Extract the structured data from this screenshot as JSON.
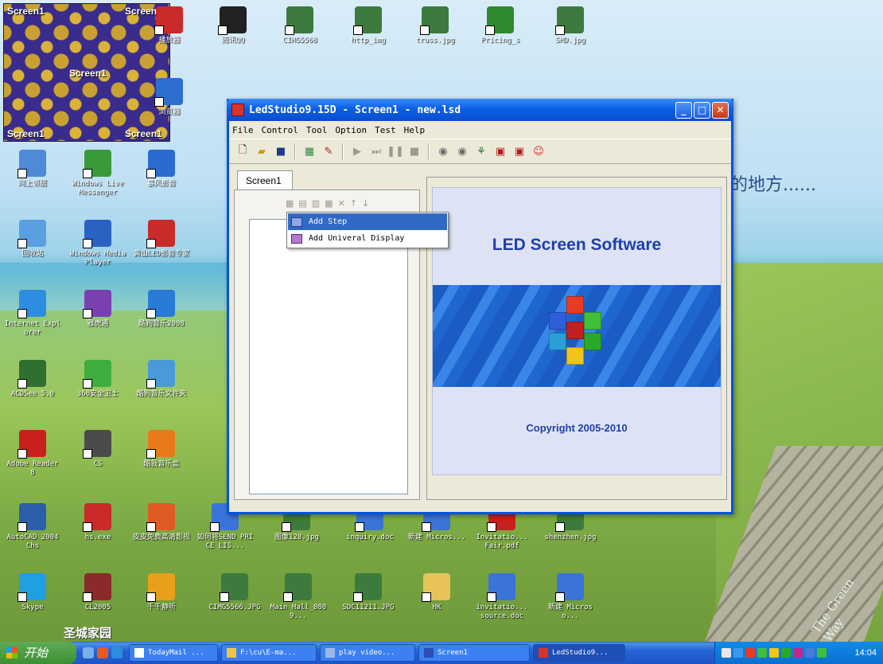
{
  "wallpaper": {
    "slogan": "的地方......",
    "corner_text": "The Green Way",
    "brand": "圣城家园"
  },
  "pattern_window": {
    "labels": [
      "Screen1",
      "Screen1",
      "Screen1",
      "Screen1",
      "Screen1"
    ]
  },
  "desktop_icons": [
    {
      "label": "网上邻居",
      "icon": "network-icon",
      "color": "#4f8ad8"
    },
    {
      "label": "Windows Live Messenger",
      "icon": "messenger-icon",
      "color": "#3a9a3a"
    },
    {
      "label": "暴风影音",
      "icon": "video-player-icon",
      "color": "#2b6bd0"
    },
    {
      "label": "回收站",
      "icon": "recycle-bin-icon",
      "color": "#5aa0e0"
    },
    {
      "label": "Windows Media Player",
      "icon": "media-player-icon",
      "color": "#2a62c4"
    },
    {
      "label": "黄山LED影音专家",
      "icon": "led-app-icon",
      "color": "#c92a2a"
    },
    {
      "label": "Internet Explorer",
      "icon": "ie-icon",
      "color": "#2d8de0"
    },
    {
      "label": "雅虎通",
      "icon": "yahoo-icon",
      "color": "#7a3fb0"
    },
    {
      "label": "酷狗音乐2008",
      "icon": "kugou-icon",
      "color": "#2a7bd6"
    },
    {
      "label": "ACDSee 5.0",
      "icon": "acdsee-icon",
      "color": "#2f6f2f"
    },
    {
      "label": "360安全卫士",
      "icon": "security-icon",
      "color": "#3fae3f"
    },
    {
      "label": "酷狗音乐文件夹",
      "icon": "folder-icon",
      "color": "#4a9ad8"
    },
    {
      "label": "Adobe Reader 8",
      "icon": "pdf-icon",
      "color": "#c8201e"
    },
    {
      "label": "CS",
      "icon": "cs-icon",
      "color": "#4b4b4b"
    },
    {
      "label": "酷我音乐盒",
      "icon": "kuwo-icon",
      "color": "#e87a1a"
    },
    {
      "label": "AutoCAD 2004 Chs",
      "icon": "autocad-icon",
      "color": "#2c5fa8"
    },
    {
      "label": "hs.exe",
      "icon": "exe-icon",
      "color": "#c92a2a"
    },
    {
      "label": "皮皮免费高清影视",
      "icon": "pipi-icon",
      "color": "#e05a24"
    },
    {
      "label": "如何将SEND PRICE LIS...",
      "icon": "doc-icon",
      "color": "#3a74d8"
    },
    {
      "label": "图像128.jpg",
      "icon": "jpg-icon",
      "color": "#3d7a3d"
    },
    {
      "label": "inquiry.doc",
      "icon": "doc-icon",
      "color": "#3a74d8"
    },
    {
      "label": "新建 Micros...",
      "icon": "doc-icon",
      "color": "#3a74d8"
    },
    {
      "label": "Invitatio... Fair.pdf",
      "icon": "pdf-icon",
      "color": "#c8201e"
    },
    {
      "label": "shenzhen.jpg",
      "icon": "jpg-icon",
      "color": "#3d7a3d"
    },
    {
      "label": "Skype",
      "icon": "skype-icon",
      "color": "#1fa0e0"
    },
    {
      "label": "CL2005",
      "icon": "cl-icon",
      "color": "#8a2a2a"
    },
    {
      "label": "千千静听",
      "icon": "ttplayer-icon",
      "color": "#e8a01a"
    },
    {
      "label": "CIMG5566.JPG",
      "icon": "jpg-icon",
      "color": "#3d7a3d"
    },
    {
      "label": "Main Hall_0809...",
      "icon": "jpg-icon",
      "color": "#3d7a3d"
    },
    {
      "label": "SDC11211.JPG",
      "icon": "jpg-icon",
      "color": "#3d7a3d"
    },
    {
      "label": "HK",
      "icon": "folder-icon",
      "color": "#e8c35a"
    },
    {
      "label": "invitatio... source.doc",
      "icon": "doc-icon",
      "color": "#3a74d8"
    },
    {
      "label": "新建 Microso...",
      "icon": "doc-icon",
      "color": "#3a74d8"
    },
    {
      "label": "播放器",
      "icon": "player-icon",
      "color": "#c92a2a"
    },
    {
      "label": "腾讯QQ",
      "icon": "qq-icon",
      "color": "#222222"
    },
    {
      "label": "CIMG5568",
      "icon": "jpg-icon",
      "color": "#3d7a3d"
    },
    {
      "label": "http_img",
      "icon": "jpg-icon",
      "color": "#3d7a3d"
    },
    {
      "label": "truss.jpg",
      "icon": "jpg-icon",
      "color": "#3d7a3d"
    },
    {
      "label": "Pricing_s",
      "icon": "xls-icon",
      "color": "#2f8a2f"
    },
    {
      "label": "SMD.jpg",
      "icon": "jpg-icon",
      "color": "#3d7a3d"
    },
    {
      "label": "浏览器",
      "icon": "browser-icon",
      "color": "#2d6fd0"
    }
  ],
  "window": {
    "title": "LedStudio9.15D - Screen1 - new.lsd",
    "menu": [
      "File",
      "Control",
      "Tool",
      "Option",
      "Test",
      "Help"
    ],
    "toolbar": [
      "new-file-icon",
      "open-folder-icon",
      "save-icon",
      "grid-icon",
      "edit-icon",
      "play-icon",
      "step-icon",
      "pause-icon",
      "stop-icon",
      "send-icon",
      "receive-icon",
      "link-icon",
      "screen-icon",
      "screen-off-icon",
      "smiley-icon"
    ],
    "tab": "Screen1",
    "context_menu": {
      "items": [
        "Add Step",
        "Add Univeral Display"
      ],
      "selected": 0
    },
    "splash": {
      "heading": "LED Screen Software",
      "copyright": "Copyright 2005-2010"
    }
  },
  "taskbar": {
    "start": "开始",
    "tasks": [
      "TodayMail ...",
      "F:\\cu\\E-ma...",
      "play video...",
      "Screen1",
      "LedStudio9..."
    ],
    "active_task": 4,
    "clock": "14:04"
  }
}
